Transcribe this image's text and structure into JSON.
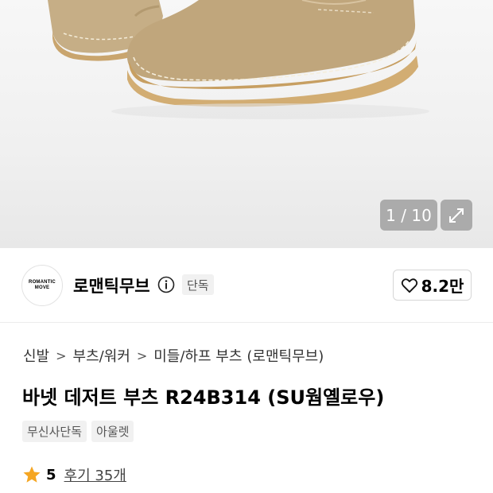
{
  "gallery": {
    "counter": "1 / 10",
    "expand_icon": "expand-arrows-icon"
  },
  "brand": {
    "logo_line1": "ROMANTIC",
    "logo_line2": "MOVE",
    "name": "로맨틱무브",
    "info_icon": "info-circle-icon",
    "badge": "단독",
    "likes": "8.2만",
    "like_icon": "heart-outline-icon"
  },
  "breadcrumb": [
    "신발",
    "부츠/워커",
    "미들/하프 부츠",
    "(로맨틱무브)"
  ],
  "product": {
    "title": "바넷 데저트 부츠 R24B314 (SU웜옐로우)",
    "tags": [
      "무신사단독",
      "아울렛"
    ]
  },
  "rating": {
    "star_icon": "star-icon",
    "star_color": "#f5a623",
    "value": "5",
    "review_label": "후기 35개"
  }
}
